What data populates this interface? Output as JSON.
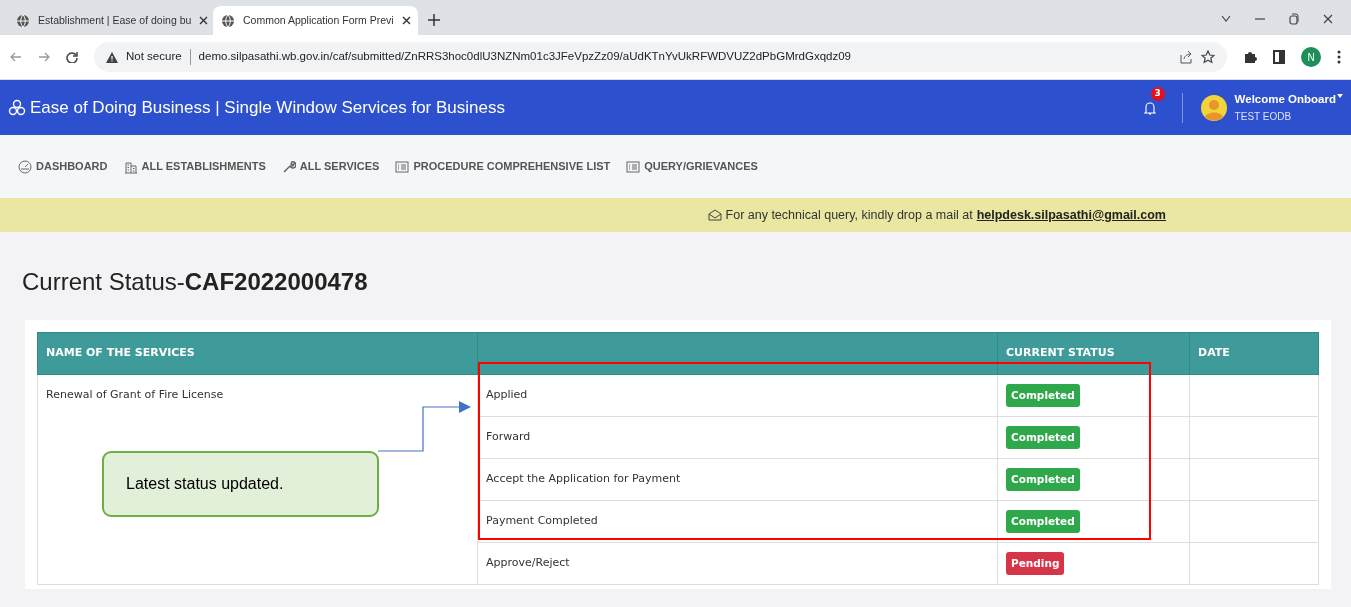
{
  "browser": {
    "tabs": [
      {
        "title": "Establishment | Ease of doing bu",
        "selected": false
      },
      {
        "title": "Common Application Form Previ",
        "selected": true
      }
    ],
    "address": {
      "security": "Not secure",
      "url": "demo.silpasathi.wb.gov.in/caf/submitted/ZnRRS3hoc0dlU3NZNm01c3JFeVpzZz09/aUdKTnYvUkRFWDVUZ2dPbGMrdGxqdz09"
    },
    "profile_initial": "N"
  },
  "header": {
    "title": "Ease of Doing Business | Single Window Services for Business",
    "notification_count": "3",
    "user_greeting": "Welcome Onboard",
    "user_name": "TEST EODB"
  },
  "nav": [
    {
      "label": "DASHBOARD",
      "kind": "dashboard"
    },
    {
      "label": "ALL ESTABLISHMENTS",
      "kind": "building"
    },
    {
      "label": "ALL SERVICES",
      "kind": "wrench"
    },
    {
      "label": "PROCEDURE COMPREHENSIVE LIST",
      "kind": "list"
    },
    {
      "label": "QUERY/GRIEVANCES",
      "kind": "list"
    }
  ],
  "banner": {
    "text": "For any technical query, kindly drop a mail at",
    "email": "helpdesk.silpasathi@gmail.com"
  },
  "page_title": "Current Status-**CAF2022000478**",
  "table": {
    "columns": [
      "NAME OF THE SERVICES",
      "CURRENT STATUS",
      "DATE"
    ],
    "service": "Renewal of Grant of Fire License",
    "steps": [
      {
        "step": "Applied",
        "status": "Completed",
        "kind": "completed"
      },
      {
        "step": "Forward",
        "status": "Completed",
        "kind": "completed"
      },
      {
        "step": "Accept the Application for Payment",
        "status": "Completed",
        "kind": "completed"
      },
      {
        "step": "Payment Completed",
        "status": "Completed",
        "kind": "completed"
      },
      {
        "step": "Approve/Reject",
        "status": "Pending",
        "kind": "pending"
      }
    ]
  },
  "annotation": {
    "callout": "Latest status updated."
  }
}
